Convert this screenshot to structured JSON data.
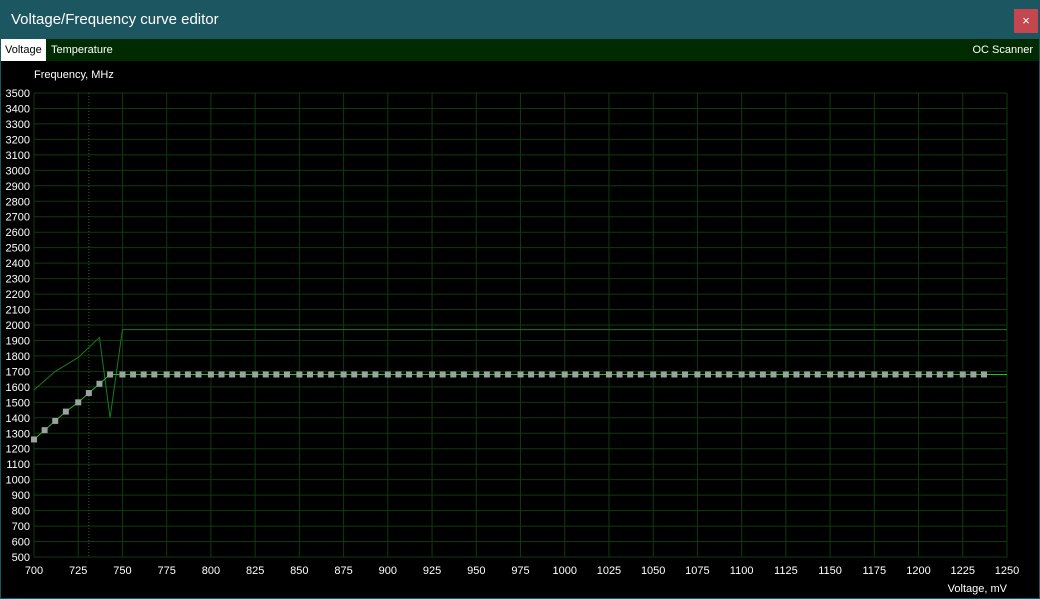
{
  "window": {
    "title": "Voltage/Frequency curve editor",
    "close_label": "×"
  },
  "tabs": [
    {
      "label": "Voltage",
      "active": true
    },
    {
      "label": "Temperature",
      "active": false
    }
  ],
  "oc_scanner_label": "OC Scanner",
  "colors": {
    "titlebar": "#1c5661",
    "tabbar": "#002b00",
    "grid": "#0f3a0f",
    "curve": "#1fbf1f",
    "point": "#9aa3a0",
    "close": "#c4474f"
  },
  "chart_data": {
    "type": "line",
    "ylabel": "Frequency, MHz",
    "xlabel": "Voltage, mV",
    "xlim": [
      700,
      1250
    ],
    "ylim": [
      500,
      3500
    ],
    "x_ticks": [
      700,
      725,
      750,
      775,
      800,
      825,
      850,
      875,
      900,
      925,
      950,
      975,
      1000,
      1025,
      1050,
      1075,
      1100,
      1125,
      1150,
      1175,
      1200,
      1225,
      1250
    ],
    "y_ticks": [
      500,
      600,
      700,
      800,
      900,
      1000,
      1100,
      1200,
      1300,
      1400,
      1500,
      1600,
      1700,
      1800,
      1900,
      2000,
      2100,
      2200,
      2300,
      2400,
      2500,
      2600,
      2700,
      2800,
      2900,
      3000,
      3100,
      3200,
      3300,
      3400,
      3500
    ],
    "grid": true,
    "current_voltage_marker": 731,
    "series": [
      {
        "role": "vf-curve",
        "x": [
          700,
          706,
          712,
          718,
          725,
          731,
          737,
          743,
          750,
          756,
          762,
          768,
          775,
          781,
          787,
          793,
          800,
          806,
          812,
          818,
          825,
          831,
          837,
          843,
          850,
          856,
          862,
          868,
          875,
          881,
          887,
          893,
          900,
          906,
          912,
          918,
          925,
          931,
          937,
          943,
          950,
          956,
          962,
          968,
          975,
          981,
          987,
          993,
          1000,
          1006,
          1012,
          1018,
          1025,
          1031,
          1037,
          1043,
          1050,
          1056,
          1062,
          1068,
          1075,
          1081,
          1087,
          1093,
          1100,
          1106,
          1112,
          1118,
          1125,
          1131,
          1137,
          1143,
          1150,
          1156,
          1162,
          1168,
          1175,
          1181,
          1187,
          1193,
          1200,
          1206,
          1212,
          1218,
          1225,
          1231,
          1237
        ],
        "y": [
          1260,
          1320,
          1380,
          1440,
          1500,
          1560,
          1620,
          1680,
          1680,
          1680,
          1680,
          1680,
          1680,
          1680,
          1680,
          1680,
          1680,
          1680,
          1680,
          1680,
          1680,
          1680,
          1680,
          1680,
          1680,
          1680,
          1680,
          1680,
          1680,
          1680,
          1680,
          1680,
          1680,
          1680,
          1680,
          1680,
          1680,
          1680,
          1680,
          1680,
          1680,
          1680,
          1680,
          1680,
          1680,
          1680,
          1680,
          1680,
          1680,
          1680,
          1680,
          1680,
          1680,
          1680,
          1680,
          1680,
          1680,
          1680,
          1680,
          1680,
          1680,
          1680,
          1680,
          1680,
          1680,
          1680,
          1680,
          1680,
          1680,
          1680,
          1680,
          1680,
          1680,
          1680,
          1680,
          1680,
          1680,
          1680,
          1680,
          1680,
          1680,
          1680,
          1680,
          1680,
          1680,
          1680,
          1680
        ],
        "tail": {
          "x": [
            1237,
            1250
          ],
          "y": [
            1680,
            1680
          ]
        }
      },
      {
        "role": "default-curve",
        "x": [
          700,
          712,
          725,
          737,
          743,
          750,
          1250
        ],
        "y": [
          1580,
          1700,
          1790,
          1920,
          1400,
          1970,
          1970
        ]
      }
    ]
  }
}
